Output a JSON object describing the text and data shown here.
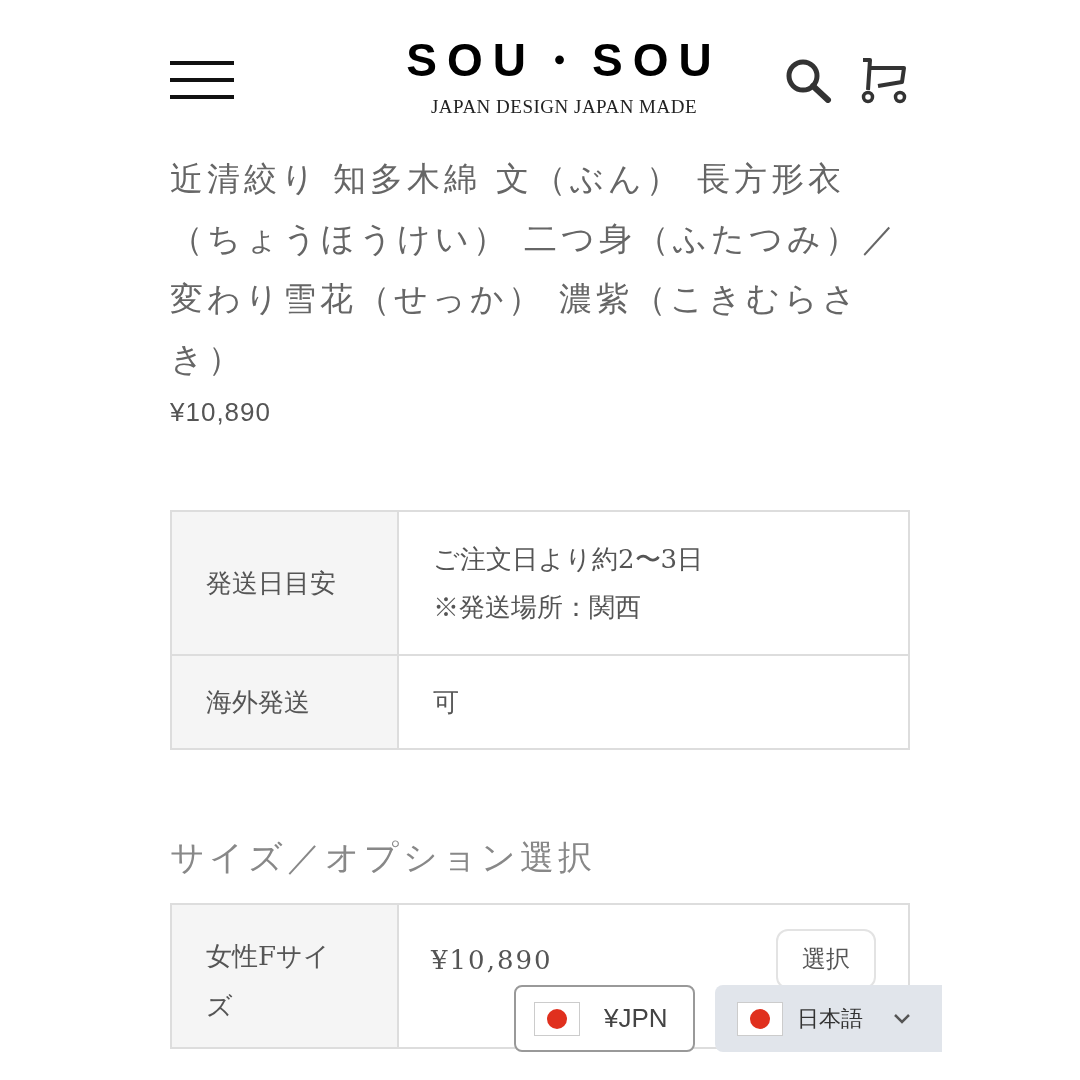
{
  "header": {
    "logo": "SOU・SOU",
    "tagline": "JAPAN DESIGN JAPAN MADE"
  },
  "product": {
    "title": "近清絞り 知多木綿 文（ぶん） 長方形衣（ちょうほうけい） 二つ身（ふたつみ）／変わり雪花（せっか） 濃紫（こきむらさき）",
    "price": "¥10,890"
  },
  "info_table": [
    {
      "label": "発送日目安",
      "lines": [
        "ご注文日より約2〜3日",
        "※発送場所：関西"
      ]
    },
    {
      "label": "海外発送",
      "lines": [
        "可"
      ]
    }
  ],
  "options": {
    "heading": "サイズ／オプション選択",
    "rows": [
      {
        "name": "女性Fサイズ",
        "price": "¥10,890",
        "button": "選択"
      }
    ]
  },
  "currency": {
    "label": "¥JPN"
  },
  "language": {
    "label": "日本語"
  }
}
